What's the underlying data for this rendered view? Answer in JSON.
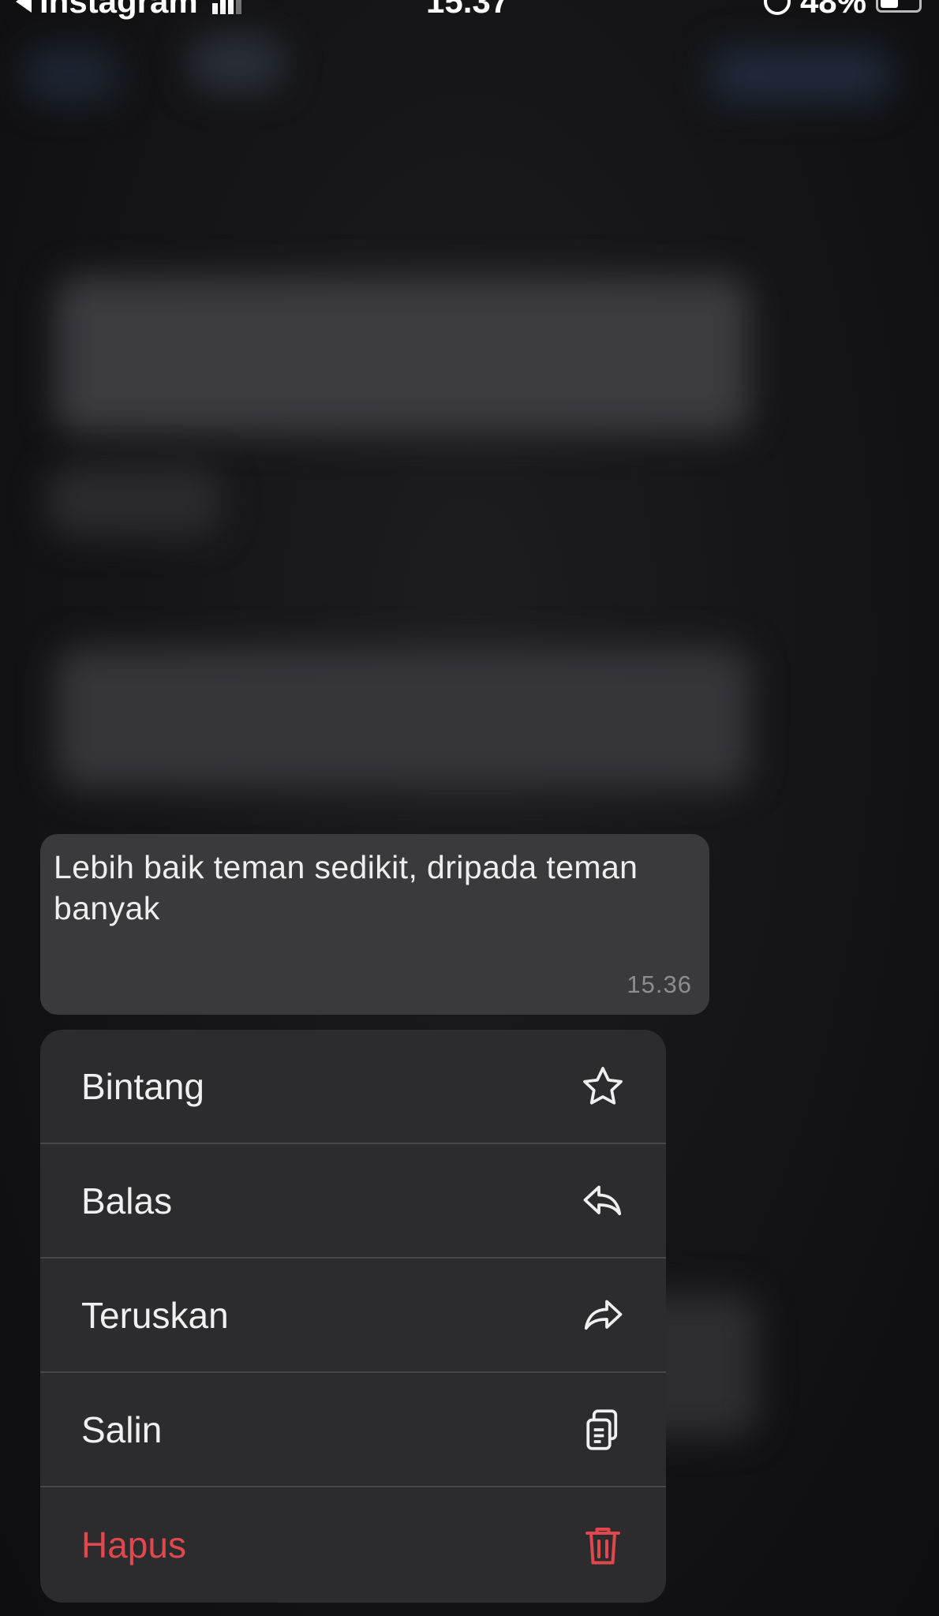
{
  "status_bar": {
    "back_app": "Instagram",
    "time": "15.37",
    "battery": "48%",
    "battery_level": 0.48
  },
  "message": {
    "text": "Lebih baik teman sedikit, dripada teman banyak",
    "time": "15.36"
  },
  "menu": {
    "items": [
      {
        "label": "Bintang",
        "icon": "star-icon"
      },
      {
        "label": "Balas",
        "icon": "reply-icon"
      },
      {
        "label": "Teruskan",
        "icon": "forward-icon"
      },
      {
        "label": "Salin",
        "icon": "copy-icon"
      },
      {
        "label": "Hapus",
        "icon": "trash-icon"
      }
    ]
  },
  "colors": {
    "danger": "#e0484d",
    "bubble": "#3a3a3d",
    "menu": "#2c2c2f"
  }
}
